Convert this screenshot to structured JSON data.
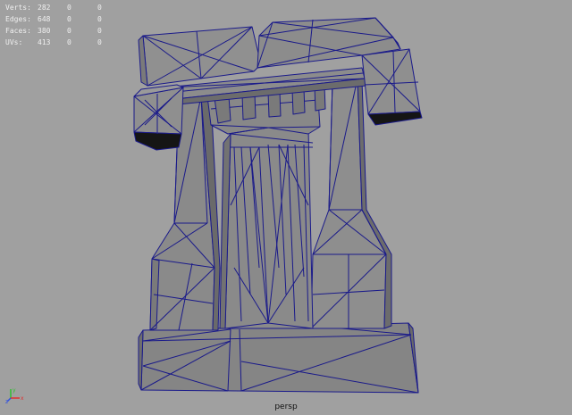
{
  "hud": {
    "rows": [
      {
        "label": "Verts:",
        "total": "282",
        "selected": "0",
        "component": "0"
      },
      {
        "label": "Edges:",
        "total": "648",
        "selected": "0",
        "component": "0"
      },
      {
        "label": "Faces:",
        "total": "380",
        "selected": "0",
        "component": "0"
      },
      {
        "label": "UVs:",
        "total": "413",
        "selected": "0",
        "component": "0"
      }
    ]
  },
  "axis": {
    "y": "y",
    "x": "x",
    "z": "z",
    "colors": {
      "x": "#e03030",
      "y": "#30c030",
      "z": "#3050e0"
    }
  },
  "camera": {
    "name": "persp"
  },
  "colors": {
    "background": "#a0a0a0",
    "mesh_fill": "#8c8c8c",
    "wire": "#1a1a8a",
    "shadow": "#151515"
  }
}
